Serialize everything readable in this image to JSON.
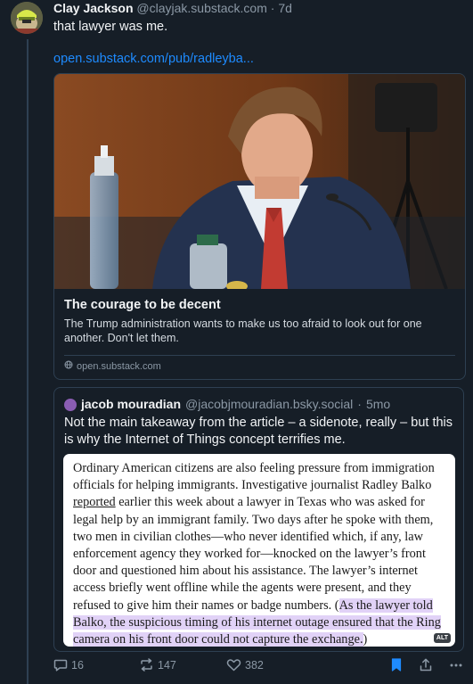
{
  "post": {
    "author": "Clay Jackson",
    "handle": "@clayjak.substack.com",
    "separator": "·",
    "time": "7d",
    "text": "that lawyer was me.",
    "link": "open.substack.com/pub/radleyba..."
  },
  "card": {
    "title": "The courage to be decent",
    "description": "The Trump administration wants to make us too afraid to look out for one another. Don't let them.",
    "domain": "open.substack.com",
    "domain_icon": "globe-icon"
  },
  "quote": {
    "author": "jacob mouradian",
    "handle": "@jacobjmouradian.bsky.social",
    "separator": "·",
    "time": "5mo",
    "text": "Not the main takeaway from the article – a sidenote, really – but this is why the Internet of Things concept terrifies me.",
    "excerpt": {
      "part1": "Ordinary American citizens are also feeling pressure from immigration officials for helping immigrants. Investigative journalist Radley Balko ",
      "underlined": "reported",
      "part2": " earlier this week about a lawyer in Texas who was asked for legal help by an immigrant family. Two days after he spoke with them, two men in civilian clothes—who never identified which, if any, law enforcement agency they worked for—knocked on the lawyer’s front door and questioned him about his assistance. The lawyer’s internet access briefly went offline while the agents were present, and they refused to give him their names or badge numbers. (",
      "highlighted": "As the lawyer told Balko, the suspicious timing of his internet outage ensured that the Ring camera on his front door could not capture the exchange.",
      "part3": ")",
      "highlight_color": "#e1d2f7"
    },
    "alt_badge": "ALT"
  },
  "actions": {
    "replies": "16",
    "reposts": "147",
    "likes": "382",
    "accent": "#1e8bff"
  }
}
